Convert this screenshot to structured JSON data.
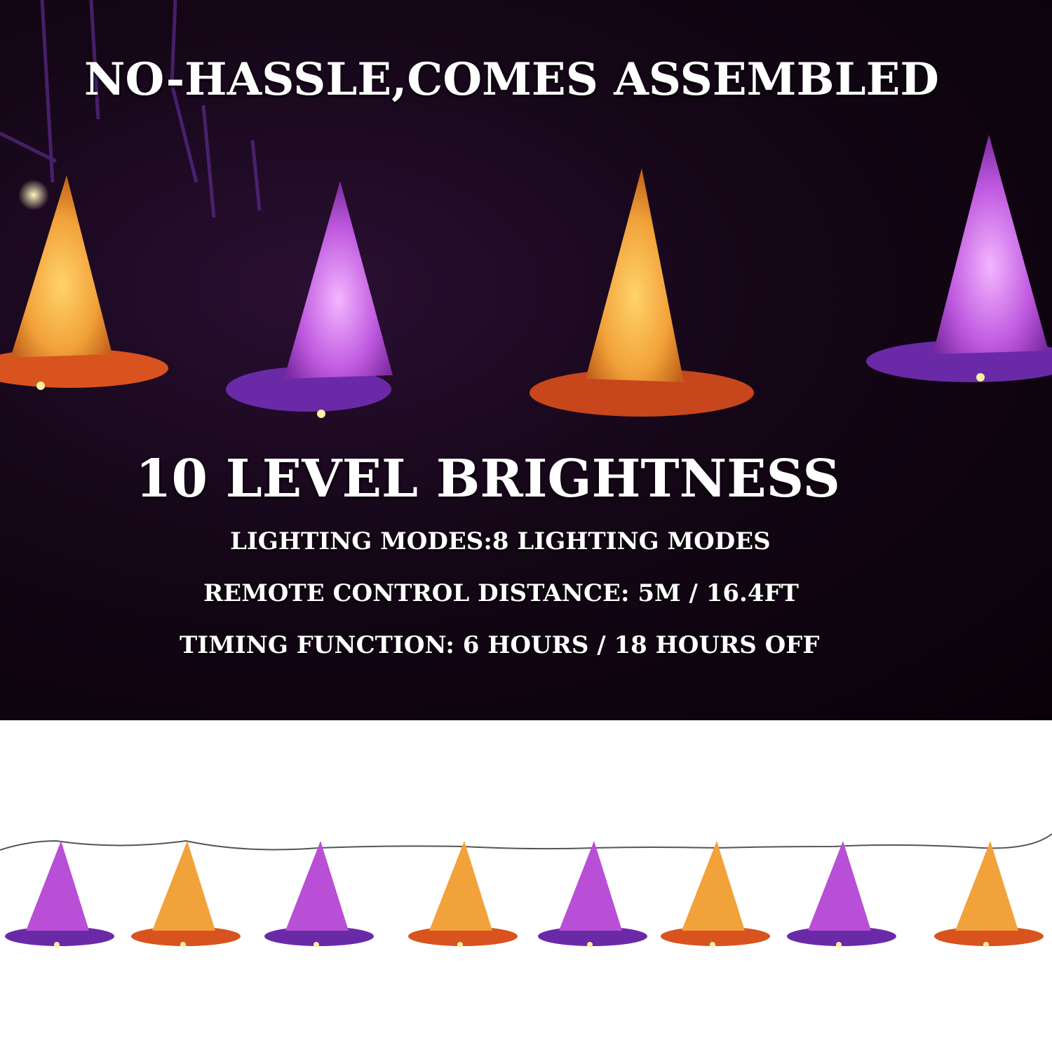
{
  "headline": "NO-HASSLE,COMES ASSEMBLED",
  "brightness_title": "10 LEVEL BRIGHTNESS",
  "specs": [
    "LIGHTING MODES:8 LIGHTING MODES",
    "REMOTE CONTROL DISTANCE: 5M / 16.4FT",
    "TIMING  FUNCTION: 6 HOURS / 18 HOURS OFF"
  ],
  "colors": {
    "hat_purple": "#b84fd6",
    "hat_orange": "#f2a23a",
    "brim_purple": "#6a2aa8",
    "brim_orange": "#d8531e",
    "background": "#120515"
  },
  "hero_hats": [
    "orange",
    "purple",
    "orange",
    "purple"
  ],
  "strip_hats": [
    "purple",
    "orange",
    "purple",
    "orange",
    "purple",
    "orange",
    "purple",
    "orange"
  ]
}
